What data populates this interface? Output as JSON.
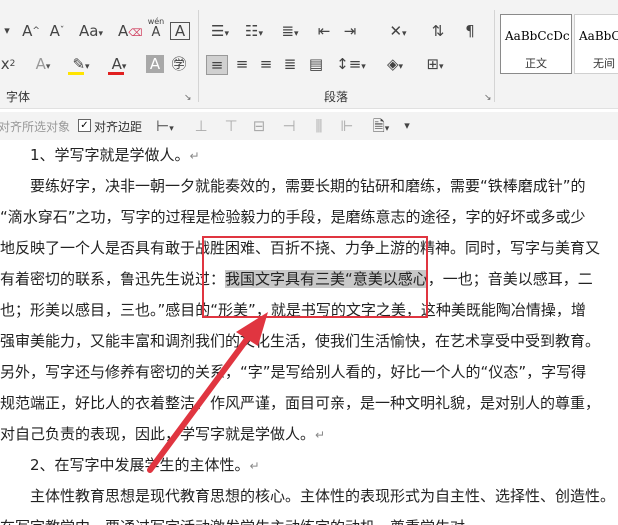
{
  "ribbon": {
    "font_group_label": "字体",
    "paragraph_group_label": "段落",
    "font_icons": [
      "grow-font-icon",
      "shrink-font-icon",
      "change-case-icon",
      "clear-format-icon",
      "phonetic-guide-icon",
      "character-border-icon",
      "superscript-icon",
      "text-effects-icon",
      "highlight-icon",
      "font-color-icon",
      "character-shading-icon",
      "enclose-character-icon"
    ],
    "phonetic_glyph": "wén",
    "styles": [
      {
        "sample": "AaBbCcDc",
        "name": "正文"
      },
      {
        "sample": "AaBbCcD",
        "name": "无间"
      }
    ]
  },
  "align_bar": {
    "align_selected_label": "对齐所选对象",
    "align_margin_label": "对齐边距",
    "align_margin_checked": true
  },
  "document": {
    "lines": [
      {
        "text": "1、学写字就是学做人。",
        "mark": "↵"
      },
      {
        "text": "要练好字，决非一朝一夕就能奏效的，需要长期的钻研和磨练，需要“铁棒磨成针”的"
      },
      {
        "text": "“滴水穿石”之功，写字的过程是检验毅力的手段，是磨练意志的途径，字的好坏或多或少"
      },
      {
        "text": "地反映了一个人是否具有敢于战胜困难、百折不挠、力争上游的精神。同时，写字与美育又"
      },
      {
        "text_before": "有着密切的联系，鲁迅先生说过：",
        "text_highlight": "我国文字具有三美“意美以感心",
        "text_after": "，一也；音美以感耳，二"
      },
      {
        "text": "也；形美以感目，三也。”感目的“形美”，就是书写的文字之美，这种美既能陶冶情操，增"
      },
      {
        "text": "强审美能力，又能丰富和调剂我们的文化生活，使我们生活愉快，在艺术享受中受到教育。"
      },
      {
        "text": "另外，写字还与修养有密切的关系，“字”是写给别人看的，好比一个人的“仪态”，字写得"
      },
      {
        "text": "规范端正，好比人的衣着整洁、作风严谨，面目可亲，是一种文明礼貌，是对别人的尊重，"
      },
      {
        "text": "对自己负责的表现，因此，学写字就是学做人。",
        "mark": "↵"
      },
      {
        "text": "2、在写字中发展学生的主体性。",
        "mark": "↵"
      },
      {
        "text": "主体性教育思想是现代教育思想的核心。主体性的表现形式为自主性、选择性、创造性。"
      },
      {
        "text": "在写字教学中，要通过写字活动激发学生主动练字的动机，尊重学生对"
      }
    ]
  },
  "colors": {
    "annotation": "#e03540",
    "highlight_color": "#ffe400",
    "font_color": "#e02020"
  }
}
